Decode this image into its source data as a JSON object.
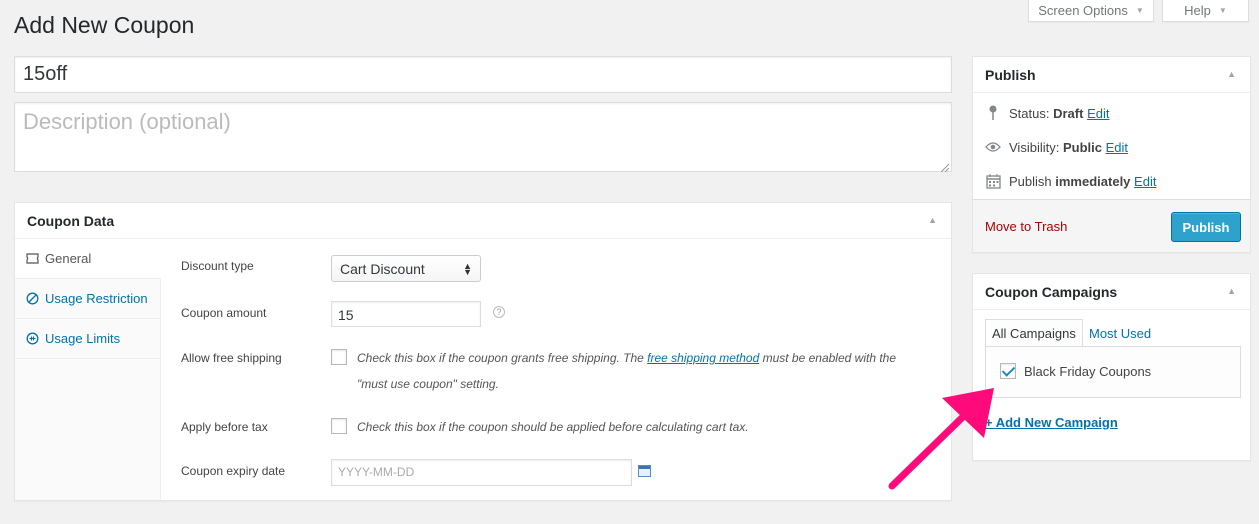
{
  "page": {
    "title": "Add New Coupon"
  },
  "top_tabs": {
    "screen_options": "Screen Options",
    "help": "Help"
  },
  "title_field": {
    "value": "15off"
  },
  "description_field": {
    "placeholder": "Description (optional)"
  },
  "coupon_data": {
    "heading": "Coupon Data",
    "tabs": [
      {
        "label": "General"
      },
      {
        "label": "Usage Restriction"
      },
      {
        "label": "Usage Limits"
      }
    ],
    "fields": {
      "discount_type": {
        "label": "Discount type",
        "value": "Cart Discount"
      },
      "coupon_amount": {
        "label": "Coupon amount",
        "value": "15"
      },
      "free_shipping": {
        "label": "Allow free shipping",
        "desc_before": "Check this box if the coupon grants free shipping. The ",
        "desc_link": "free shipping method",
        "desc_after": " must be enabled with the",
        "desc_line2": "\"must use coupon\" setting."
      },
      "apply_before_tax": {
        "label": "Apply before tax",
        "desc": "Check this box if the coupon should be applied before calculating cart tax."
      },
      "expiry_date": {
        "label": "Coupon expiry date",
        "placeholder": "YYYY-MM-DD"
      }
    }
  },
  "publish": {
    "heading": "Publish",
    "status_label": "Status:",
    "status_value": "Draft",
    "visibility_label": "Visibility:",
    "visibility_value": "Public",
    "publish_label": "Publish",
    "publish_value": "immediately",
    "edit": "Edit",
    "trash": "Move to Trash",
    "button": "Publish"
  },
  "campaigns": {
    "heading": "Coupon Campaigns",
    "tab_all": "All Campaigns",
    "tab_most_used": "Most Used",
    "items": [
      {
        "label": "Black Friday Coupons",
        "checked": true
      }
    ],
    "add_new": "+ Add New Campaign"
  },
  "colors": {
    "link": "#0073aa",
    "publish_button": "#2ea2cc",
    "trash": "#aa0000",
    "arrow": "#ff0a7a"
  }
}
